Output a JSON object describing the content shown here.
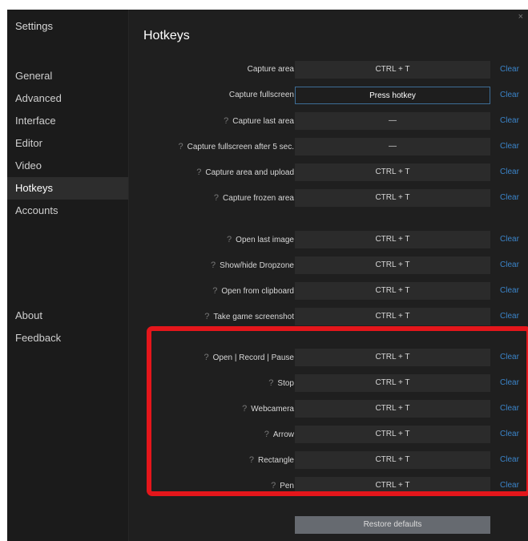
{
  "sidebar": {
    "title": "Settings",
    "items": [
      {
        "label": "General"
      },
      {
        "label": "Advanced"
      },
      {
        "label": "Interface"
      },
      {
        "label": "Editor"
      },
      {
        "label": "Video"
      },
      {
        "label": "Hotkeys",
        "active": true
      },
      {
        "label": "Accounts"
      }
    ],
    "bottom_items": [
      {
        "label": "About"
      },
      {
        "label": "Feedback"
      }
    ]
  },
  "window": {
    "close_glyph": "×"
  },
  "main": {
    "title": "Hotkeys",
    "help_glyph": "?",
    "clear_label": "Clear",
    "hotkeys": [
      {
        "label": "Capture area",
        "value": "CTRL + T",
        "help": false
      },
      {
        "label": "Capture fullscreen",
        "value": "Press hotkey",
        "help": false,
        "focused": true
      },
      {
        "label": "Capture last area",
        "value": "—",
        "help": true
      },
      {
        "label": "Capture fullscreen after 5 sec.",
        "value": "—",
        "help": true
      },
      {
        "label": "Capture area and upload",
        "value": "CTRL + T",
        "help": true
      },
      {
        "label": "Capture frozen area",
        "value": "CTRL + T",
        "help": true
      },
      {
        "label": "Open last image",
        "value": "CTRL + T",
        "help": true
      },
      {
        "label": "Show/hide Dropzone",
        "value": "CTRL + T",
        "help": true
      },
      {
        "label": "Open from clipboard",
        "value": "CTRL + T",
        "help": true
      },
      {
        "label": "Take game screenshot",
        "value": "CTRL + T",
        "help": true
      },
      {
        "label": "Open | Record | Pause",
        "value": "CTRL + T",
        "help": true
      },
      {
        "label": "Stop",
        "value": "CTRL + T",
        "help": true
      },
      {
        "label": "Webcamera",
        "value": "CTRL + T",
        "help": true
      },
      {
        "label": "Arrow",
        "value": "CTRL + T",
        "help": true
      },
      {
        "label": "Rectangle",
        "value": "CTRL + T",
        "help": true
      },
      {
        "label": "Pen",
        "value": "CTRL + T",
        "help": true
      }
    ],
    "restore_label": "Restore defaults"
  },
  "colors": {
    "accent": "#3b84c9",
    "highlight": "#e4161b",
    "background": "#1f1f1f"
  }
}
